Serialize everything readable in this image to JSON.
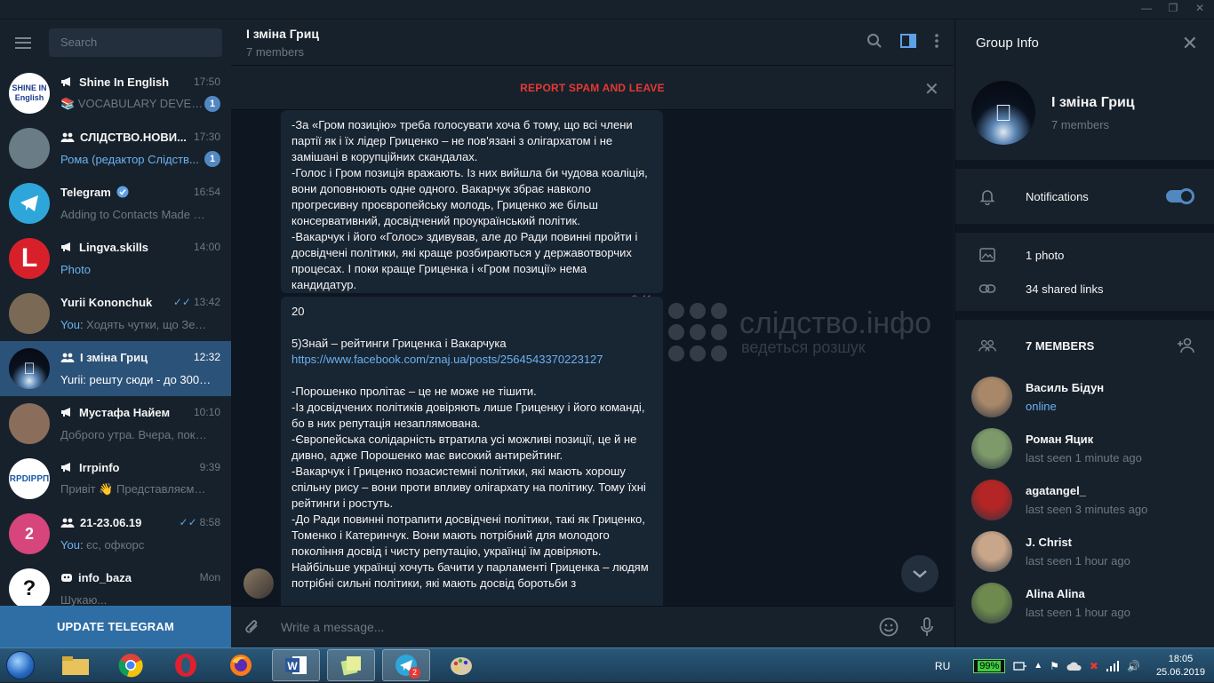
{
  "window": {
    "controls": [
      "minimize",
      "restore",
      "close"
    ]
  },
  "sidebar": {
    "search_placeholder": "Search",
    "chats": [
      {
        "name": "Shine In English",
        "kind": "channel",
        "time": "17:50",
        "preview": "📚 VOCABULARY DEVEL...",
        "badge": "1",
        "avatar_color": "#ffffff",
        "avatar_text": "SHINE IN English"
      },
      {
        "name": "СЛІДСТВО.НОВИ...",
        "kind": "group",
        "time": "17:30",
        "preview": "Рома (редактор Слідств...",
        "preview_colored": true,
        "badge": "1",
        "avatar_color": "#6a7c86",
        "avatar_text": ""
      },
      {
        "name": "Telegram",
        "kind": "verified",
        "time": "16:54",
        "preview": "Adding to Contacts Made Ea...",
        "badge": "",
        "avatar_color": "#2ea6da",
        "avatar_text": ""
      },
      {
        "name": "Lingva.skills",
        "kind": "channel",
        "time": "14:00",
        "preview": "Photo",
        "preview_colored": true,
        "badge": "",
        "avatar_color": "#d8202b",
        "avatar_text": "L"
      },
      {
        "name": "Yurii Kononchuk",
        "kind": "user",
        "time": "13:42",
        "read": true,
        "who": "You:",
        "preview": " Ходять чутки, що Зеле...",
        "badge": "",
        "avatar_color": "#7a6a55",
        "avatar_text": ""
      },
      {
        "name": "І зміна Гриц",
        "kind": "group",
        "time": "12:32",
        "preview": "Yurii: решту сюди - до 300  h...",
        "badge": "",
        "avatar_color": "#0a1220",
        "avatar_text": "",
        "active": true
      },
      {
        "name": "Мустафа Найем",
        "kind": "channel",
        "time": "10:10",
        "preview": "Доброго утра. Вчера, пока ...",
        "badge": "",
        "avatar_color": "#8a6d5a",
        "avatar_text": ""
      },
      {
        "name": "Irrpinfo",
        "kind": "channel",
        "time": "9:39",
        "preview": "Привіт 👋 Представляємо ...",
        "badge": "",
        "avatar_color": "#ffffff",
        "avatar_text": "RPDIPPП"
      },
      {
        "name": "21-23.06.19",
        "kind": "group",
        "time": "8:58",
        "read": true,
        "who": "You:",
        "preview": " єс, офкорс",
        "badge": "",
        "avatar_color": "#d6457b",
        "avatar_text": "2"
      },
      {
        "name": "info_baza",
        "kind": "bot",
        "time": "Mon",
        "preview": "Шукаю...",
        "badge": "",
        "avatar_color": "#ffffff",
        "avatar_text": "?"
      }
    ],
    "update_label": "UPDATE TELEGRAM"
  },
  "chat": {
    "title": "І зміна Гриц",
    "subtitle": "7 members",
    "report_label": "REPORT SPAM AND LEAVE",
    "messages": [
      {
        "text": "-За «Гром позицію» треба голосувати хоча б тому, що всі члени партії як і їх лідер Гриценко – не пов'язані з олігархатом і не замішані в корупційних скандалах.\n-Голос і Гром позиція вражають. Із них вийшла би чудова коаліція, вони доповнюють одне одного. Вакарчук збрає навколо прогресивну проєвропейську молодь, Гриценко же більш консервативний, досвідчений проукраїнський політик.\n-Вакарчук і його «Голос» здивував, але до Ради повинні пройти і досвідчені політики, які краще розбираються у державотворчих процесах. І поки краще Гриценка і «Гром позиції» нема кандидатур.",
        "time": "8:41"
      },
      {
        "intro": "20\n\n5)Знай – рейтинги Гриценка і Вакарчука",
        "link": "https://www.facebook.com/znaj.ua/posts/2564543370223127",
        "body": "-Порошенко пролітає – це не може не тішити.\n-Із досвідчених політиків довіряють лише Гриценку і його команді, бо в них репутація незаплямована.\n-Європейська солідарність втратила усі можливі позиції, це й не дивно, адже Порошенко має високий антирейтинг.\n-Вакарчук і Гриценко позасистемні політики, які мають хорошу спільну рису – вони проти впливу олігархату на політику. Тому їхні рейтинги і ростуть.\n-До Ради повинні потрапити досвідчені політики, такі як Гриценко, Томенко і Катеринчук. Вони мають потрібний для молодого покоління досвід і чисту репутацію, українці їм довіряють.\nНайбільше українці хочуть бачити у парламенті Гриценка – людям потрібні сильні політики, які мають досвід боротьби з"
      }
    ],
    "watermark": {
      "title": "слідство.інфо",
      "tagline": "ведеться розшук"
    },
    "composer_placeholder": "Write a message..."
  },
  "group_info": {
    "header": "Group Info",
    "name": "І зміна Гриц",
    "members_count": "7 members",
    "notifications_label": "Notifications",
    "notifications_on": true,
    "media": [
      {
        "icon": "photo-icon",
        "label": "1 photo"
      },
      {
        "icon": "link-icon",
        "label": "34 shared links"
      }
    ],
    "members_header": "7 MEMBERS",
    "members": [
      {
        "name": "Василь Бідун",
        "status": "online",
        "online": true,
        "avatar_color": "#a88868"
      },
      {
        "name": "Роман Яцик",
        "status": "last seen 1 minute ago",
        "online": false,
        "avatar_color": "#7e9a6a"
      },
      {
        "name": "agatangel_",
        "status": "last seen 3 minutes ago",
        "online": false,
        "avatar_color": "#b42525"
      },
      {
        "name": "J. Christ",
        "status": "last seen 1 hour ago",
        "online": false,
        "avatar_color": "#c8a68a"
      },
      {
        "name": "Alina Alina",
        "status": "last seen 1 hour ago",
        "online": false,
        "avatar_color": "#6e8a4e"
      }
    ]
  },
  "taskbar": {
    "apps": [
      "explorer",
      "chrome",
      "opera",
      "firefox",
      "word",
      "sticky-notes",
      "telegram",
      "paint"
    ],
    "telegram_badge": "2",
    "lang": "RU",
    "battery": "99%",
    "time": "18:05",
    "date": "25.06.2019"
  }
}
